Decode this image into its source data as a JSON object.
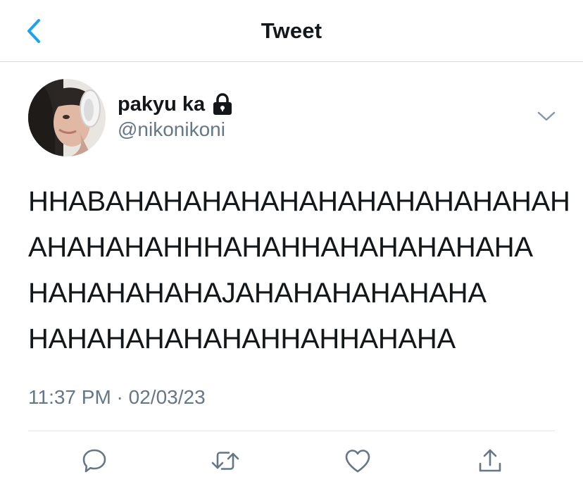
{
  "header": {
    "title": "Tweet",
    "back_icon": "chevron-left-icon"
  },
  "author": {
    "display_name": "pakyu ka",
    "handle": "@nikonikoni",
    "protected_icon": "lock-icon",
    "avatar": "avatar"
  },
  "tweet": {
    "lines": [
      "HHABAHAHAHAHAHAHAHAHAHAHAHAH",
      "AHAHAHAHHHAHAHHAHAHAHAHAHA",
      "HAHAHAHAHAJAHAHAHAHAHAHA",
      "HAHAHAHAHAHAHHAHHAHAHA"
    ],
    "meta": "11:37 PM · 02/03/23"
  },
  "actions": [
    {
      "name": "reply-icon"
    },
    {
      "name": "retweet-icon"
    },
    {
      "name": "like-icon"
    },
    {
      "name": "share-icon"
    }
  ],
  "colors": {
    "accent": "#1da1f2",
    "text": "#14171a",
    "secondary": "#657786",
    "icon": "#657786",
    "divider": "#e1e8ed"
  }
}
